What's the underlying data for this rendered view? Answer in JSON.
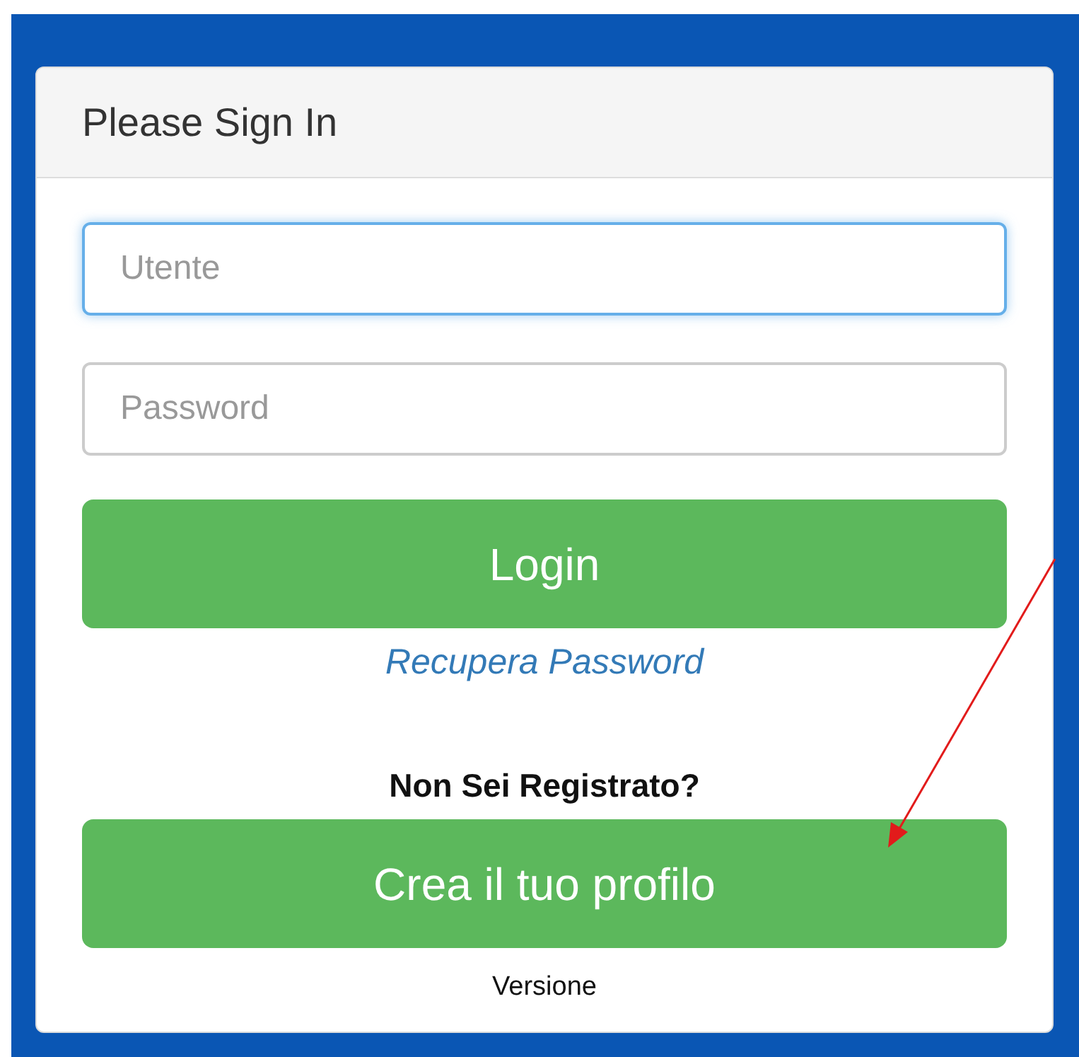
{
  "panel": {
    "title": "Please Sign In"
  },
  "fields": [
    {
      "placeholder": "Utente",
      "focused": true
    },
    {
      "placeholder": "Password",
      "focused": false
    }
  ],
  "login_button": "Login",
  "recover_link": "Recupera Password",
  "register_prompt": "Non Sei Registrato?",
  "register_button": "Crea il tuo profilo",
  "version": "Versione"
}
